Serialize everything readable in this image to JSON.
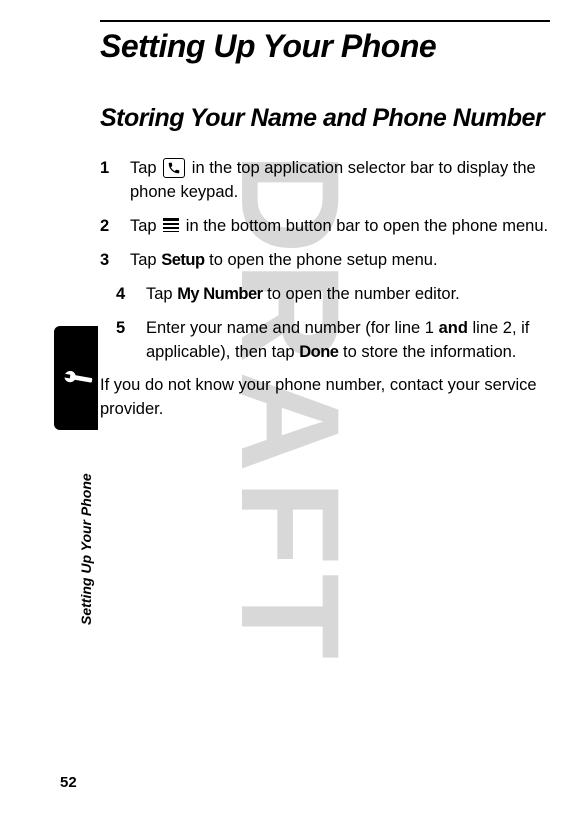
{
  "watermark": "DRAFT",
  "title": "Setting Up Your Phone",
  "section": "Storing Your Name and Phone Number",
  "steps": [
    {
      "num": "1",
      "pre": "Tap ",
      "post": " in the top application selector bar to display the phone keypad.",
      "icon": "phone"
    },
    {
      "num": "2",
      "pre": "Tap ",
      "post": " in the bottom button bar to open the phone menu.",
      "icon": "menu"
    },
    {
      "num": "3",
      "pre": "Tap ",
      "label": "Setup",
      "post": " to open the phone setup menu."
    },
    {
      "num": "4",
      "pre": "Tap ",
      "label": "My Number",
      "post": " to open the number editor."
    },
    {
      "num": "5",
      "pre": "Enter your name and number (for line 1 ",
      "bold": "and",
      "mid": " line 2, if applicable), then tap ",
      "label": "Done",
      "post": " to store the information."
    }
  ],
  "footer": "If you do not know your phone number, contact your service provider.",
  "sideLabel": "Setting Up Your Phone",
  "pageNum": "52"
}
